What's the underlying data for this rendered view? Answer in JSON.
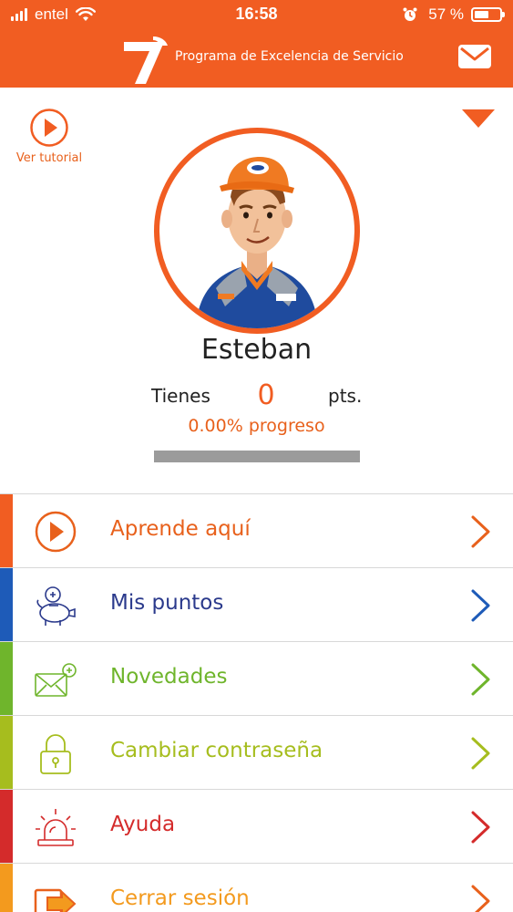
{
  "status_bar": {
    "carrier": "entel",
    "time": "16:58",
    "battery": "57 %",
    "icons": [
      "signal-icon",
      "wifi-icon",
      "alarm-icon",
      "battery-icon"
    ]
  },
  "header": {
    "title": "Programa de Excelencia de Servicio",
    "logo": "seven-logo",
    "action_icon": "mail-icon"
  },
  "profile": {
    "tutorial_label": "Ver tutorial",
    "name": "Esteban",
    "points_prefix": "Tienes",
    "points_value": "0",
    "points_suffix": "pts.",
    "progress_text": "0.00% progreso",
    "progress_fraction": 0.0,
    "avatar": "worker-avatar"
  },
  "menu": {
    "items": [
      {
        "label": "Aprende aquí",
        "color": "#e8611c",
        "icon": "play-icon"
      },
      {
        "label": "Mis puntos",
        "color": "#2b3a8c",
        "icon": "piggy-bank-icon"
      },
      {
        "label": "Novedades",
        "color": "#6fb52c",
        "icon": "envelope-plus-icon"
      },
      {
        "label": "Cambiar contraseña",
        "color": "#a6bd1e",
        "icon": "lock-icon"
      },
      {
        "label": "Ayuda",
        "color": "#d42b2b",
        "icon": "siren-icon"
      },
      {
        "label": "Cerrar sesión",
        "color": "#f39a1e",
        "icon": "logout-icon"
      }
    ],
    "chevron_colors": [
      "#e8611c",
      "#1e5bb8",
      "#6fb52c",
      "#a6bd1e",
      "#d42b2b",
      "#e8611c"
    ],
    "bar_colors": [
      "#f15d22",
      "#1e5bb8",
      "#6fb52c",
      "#a6bd1e",
      "#d42b2b",
      "#f39a1e"
    ]
  },
  "colors": {
    "brand": "#f15d22",
    "progress_track": "#9b9b9b"
  }
}
